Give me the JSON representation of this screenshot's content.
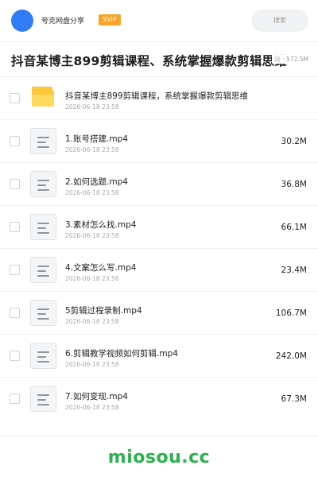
{
  "header": {
    "user_name": "夸克网盘分享",
    "badge": "SVIP",
    "search_placeholder": "搜索"
  },
  "title": {
    "text": "抖音某博主899剪辑课程、系统掌握爆款剪辑思维",
    "meta_faded": "简",
    "meta_sep": "·",
    "total_size": "572.5M"
  },
  "files": [
    {
      "name": "抖音某博主899剪辑课程，系统掌握爆款剪辑思维",
      "date": "2026-06-18 23:58",
      "size": "",
      "icon": "folder-icon"
    },
    {
      "name": "1.账号搭建.mp4",
      "date": "2026-06-18 23:58",
      "size": "30.2M",
      "icon": "video-file-icon"
    },
    {
      "name": "2.如何选题.mp4",
      "date": "2026-06-18 23:58",
      "size": "36.8M",
      "icon": "video-file-icon"
    },
    {
      "name": "3.素材怎么找.mp4",
      "date": "2026-06-18 23:58",
      "size": "66.1M",
      "icon": "video-file-icon"
    },
    {
      "name": "4.文案怎么写.mp4",
      "date": "2026-06-18 23:58",
      "size": "23.4M",
      "icon": "video-file-icon"
    },
    {
      "name": "5剪辑过程录制.mp4",
      "date": "2026-06-18 23:58",
      "size": "106.7M",
      "icon": "video-file-icon"
    },
    {
      "name": "6.剪辑教学视频如何剪辑.mp4",
      "date": "2026-06-18 23:58",
      "size": "242.0M",
      "icon": "video-file-icon"
    },
    {
      "name": "7.如何变现.mp4",
      "date": "2026-06-18 23:58",
      "size": "67.3M",
      "icon": "video-file-icon"
    }
  ],
  "watermark": "miosou.cc",
  "colors": {
    "accent_blue": "#2f7cf6",
    "svip_orange": "#f7a427",
    "folder_yellow": "#ffc53d",
    "watermark_green": "#2bb24c"
  }
}
